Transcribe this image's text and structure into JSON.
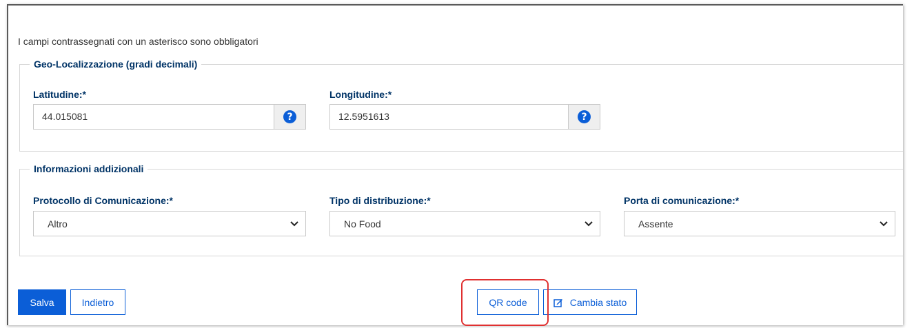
{
  "form": {
    "required_note": "I campi contrassegnati con un asterisco sono obbligatori",
    "geo": {
      "legend": "Geo-Localizzazione (gradi decimali)",
      "latitude_label": "Latitudine:*",
      "latitude_value": "44.015081",
      "longitude_label": "Longitudine:*",
      "longitude_value": "12.5951613",
      "help_icon": "question-circle-icon"
    },
    "info": {
      "legend": "Informazioni addizionali",
      "protocol_label": "Protocollo di Comunicazione:*",
      "protocol_value": "Altro",
      "distribution_label": "Tipo di distribuzione:*",
      "distribution_value": "No Food",
      "port_label": "Porta di comunicazione:*",
      "port_value": "Assente"
    }
  },
  "actions": {
    "save_label": "Salva",
    "back_label": "Indietro",
    "qr_label": "QR code",
    "change_state_label": "Cambia stato",
    "change_state_icon": "edit-icon"
  },
  "colors": {
    "primary": "#0b5ed7",
    "label": "#003366",
    "highlight": "#e03030"
  }
}
